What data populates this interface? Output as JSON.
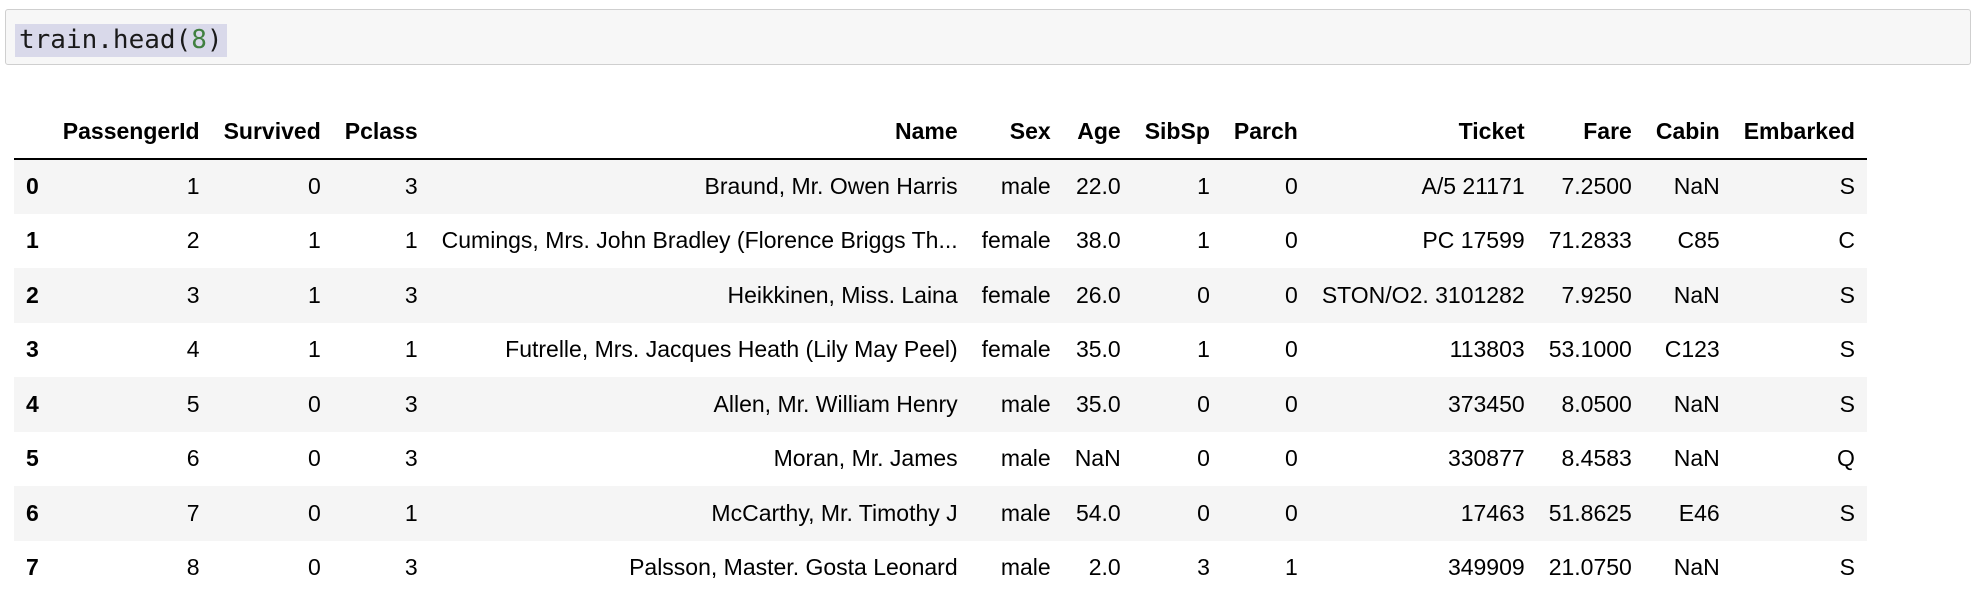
{
  "cell": {
    "code_prefix": "train.head(",
    "code_arg": "8",
    "code_suffix": ")"
  },
  "dataframe": {
    "columns": [
      "",
      "PassengerId",
      "Survived",
      "Pclass",
      "Name",
      "Sex",
      "Age",
      "SibSp",
      "Parch",
      "Ticket",
      "Fare",
      "Cabin",
      "Embarked"
    ],
    "rows": [
      [
        "0",
        "1",
        "0",
        "3",
        "Braund, Mr. Owen Harris",
        "male",
        "22.0",
        "1",
        "0",
        "A/5 21171",
        "7.2500",
        "NaN",
        "S"
      ],
      [
        "1",
        "2",
        "1",
        "1",
        "Cumings, Mrs. John Bradley (Florence Briggs Th...",
        "female",
        "38.0",
        "1",
        "0",
        "PC 17599",
        "71.2833",
        "C85",
        "C"
      ],
      [
        "2",
        "3",
        "1",
        "3",
        "Heikkinen, Miss. Laina",
        "female",
        "26.0",
        "0",
        "0",
        "STON/O2. 3101282",
        "7.9250",
        "NaN",
        "S"
      ],
      [
        "3",
        "4",
        "1",
        "1",
        "Futrelle, Mrs. Jacques Heath (Lily May Peel)",
        "female",
        "35.0",
        "1",
        "0",
        "113803",
        "53.1000",
        "C123",
        "S"
      ],
      [
        "4",
        "5",
        "0",
        "3",
        "Allen, Mr. William Henry",
        "male",
        "35.0",
        "0",
        "0",
        "373450",
        "8.0500",
        "NaN",
        "S"
      ],
      [
        "5",
        "6",
        "0",
        "3",
        "Moran, Mr. James",
        "male",
        "NaN",
        "0",
        "0",
        "330877",
        "8.4583",
        "NaN",
        "Q"
      ],
      [
        "6",
        "7",
        "0",
        "1",
        "McCarthy, Mr. Timothy J",
        "male",
        "54.0",
        "0",
        "0",
        "17463",
        "51.8625",
        "E46",
        "S"
      ],
      [
        "7",
        "8",
        "0",
        "3",
        "Palsson, Master. Gosta Leonard",
        "male",
        "2.0",
        "3",
        "1",
        "349909",
        "21.0750",
        "NaN",
        "S"
      ]
    ]
  }
}
